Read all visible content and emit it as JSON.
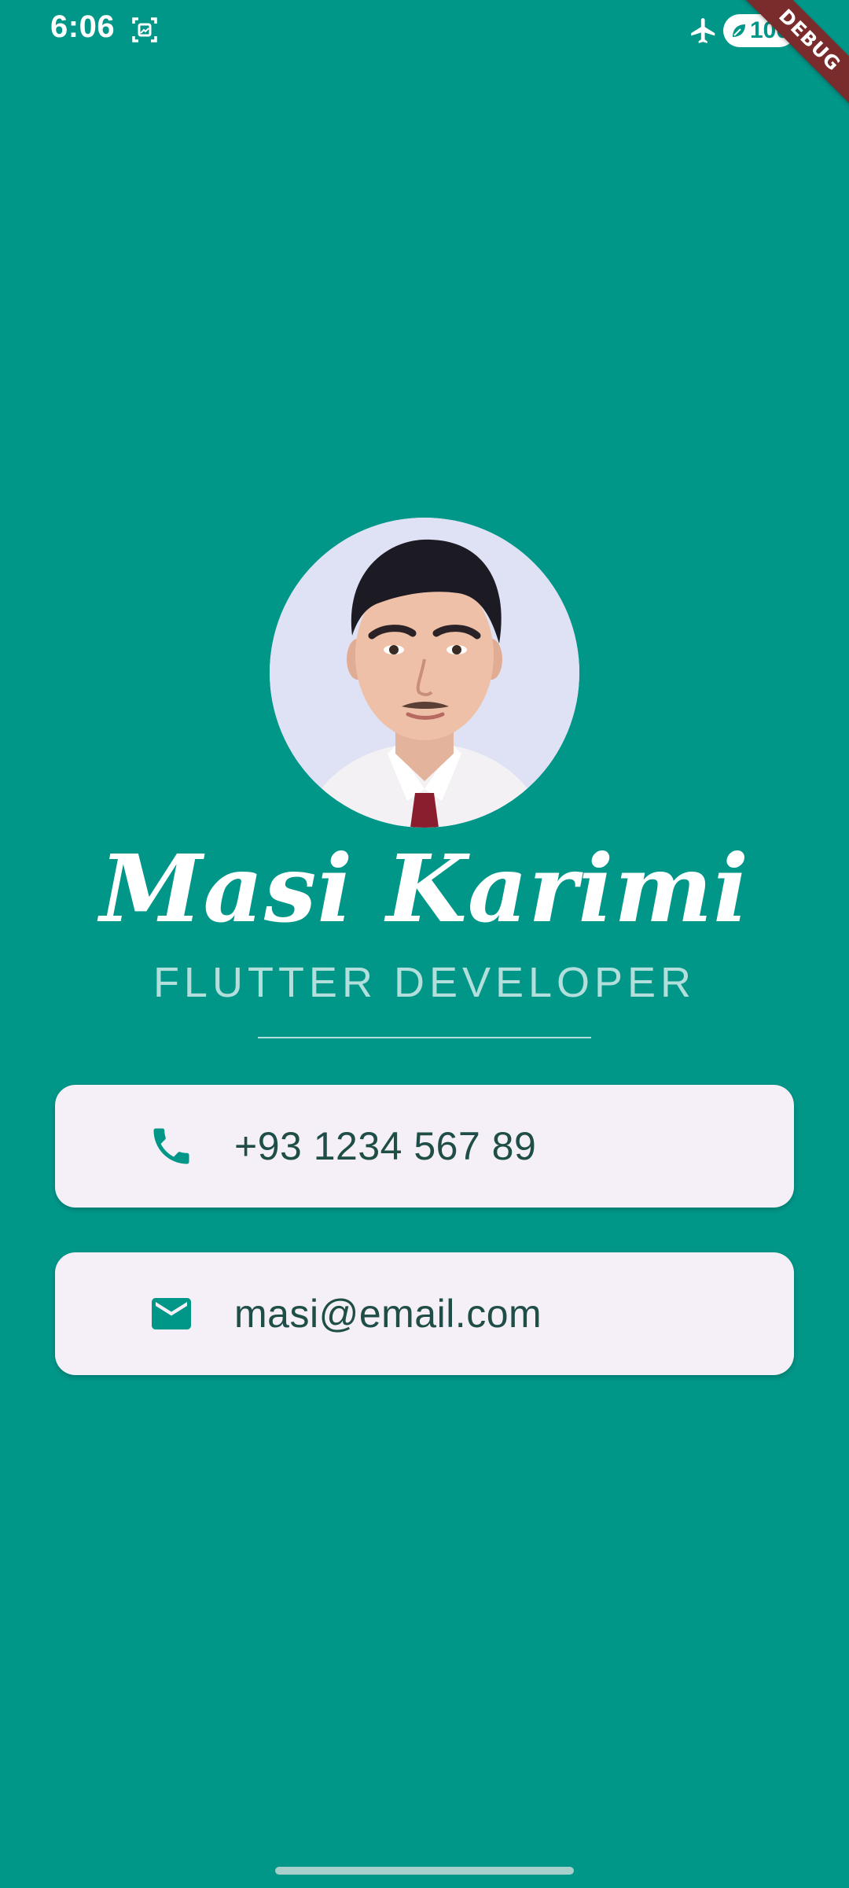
{
  "status_bar": {
    "time": "6:06",
    "battery": "100"
  },
  "debug_banner": "DEBUG",
  "profile": {
    "name": "Masi Karimi",
    "title": "FLUTTER DEVELOPER"
  },
  "contacts": {
    "phone": "+93 1234 567 89",
    "email": "masi@email.com"
  },
  "colors": {
    "background": "#009688",
    "card": "#f5f0f7",
    "title": "#b2dfdb",
    "icon": "#009688",
    "debug_banner": "#7a2b2b"
  },
  "icons": {
    "status": [
      "screenshot-icon",
      "airplane-icon",
      "battery-icon"
    ],
    "phone": "phone-icon",
    "email": "mail-icon"
  }
}
